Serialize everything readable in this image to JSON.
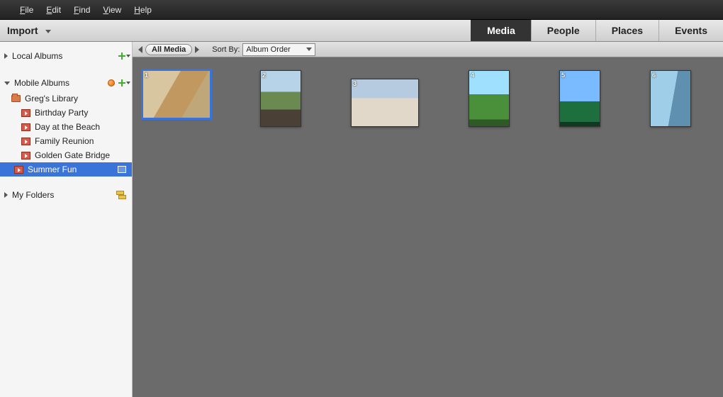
{
  "menubar": {
    "items": [
      {
        "hot": "F",
        "rest": "ile"
      },
      {
        "hot": "E",
        "rest": "dit"
      },
      {
        "hot": "F",
        "rest": "ind"
      },
      {
        "hot": "V",
        "rest": "iew"
      },
      {
        "hot": "H",
        "rest": "elp"
      }
    ]
  },
  "toolbar": {
    "import_label": "Import",
    "tabs": [
      {
        "label": "Media",
        "active": true
      },
      {
        "label": "People",
        "active": false
      },
      {
        "label": "Places",
        "active": false
      },
      {
        "label": "Events",
        "active": false
      }
    ]
  },
  "sidebar": {
    "sections": [
      {
        "label": "Local Albums",
        "expanded": false,
        "icons": [
          "plus"
        ]
      },
      {
        "label": "Mobile Albums",
        "expanded": true,
        "icons": [
          "dot",
          "plus"
        ],
        "library_label": "Greg's Library",
        "albums": [
          {
            "label": "Birthday Party",
            "selected": false
          },
          {
            "label": "Day at the Beach",
            "selected": false
          },
          {
            "label": "Family Reunion",
            "selected": false
          },
          {
            "label": "Golden Gate Bridge",
            "selected": false
          },
          {
            "label": "Summer Fun",
            "selected": true
          }
        ]
      },
      {
        "label": "My Folders",
        "expanded": false,
        "icons": [
          "swap"
        ]
      }
    ]
  },
  "filterbar": {
    "pill": "All Media",
    "sort_label": "Sort By:",
    "sort_value": "Album Order"
  },
  "grid": {
    "thumbs": [
      {
        "n": "1",
        "orient": "land",
        "cls": "p1",
        "selected": true
      },
      {
        "n": "2",
        "orient": "port",
        "cls": "p2",
        "selected": false
      },
      {
        "n": "3",
        "orient": "land",
        "cls": "p3",
        "selected": false
      },
      {
        "n": "4",
        "orient": "port",
        "cls": "p4",
        "selected": false
      },
      {
        "n": "5",
        "orient": "port",
        "cls": "p5",
        "selected": false
      },
      {
        "n": "6",
        "orient": "port",
        "cls": "p6",
        "selected": false
      }
    ]
  }
}
